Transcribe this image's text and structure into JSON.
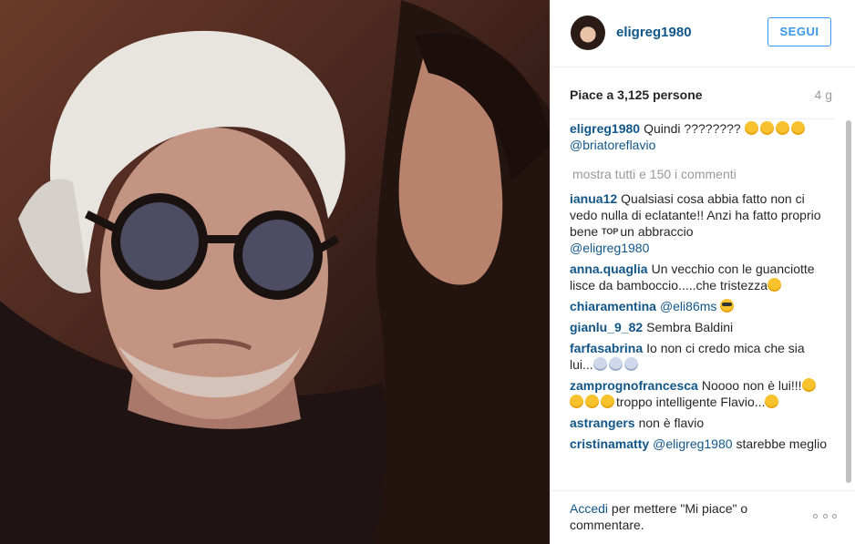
{
  "header": {
    "username": "eligreg1980",
    "follow_label": "SEGUI"
  },
  "stats": {
    "likes": "Piace a 3,125 persone",
    "age": "4 g"
  },
  "caption": {
    "author": "eligreg1980",
    "text": "Quindi ????????",
    "emojis": [
      "grinning-squint-face",
      "winking-tongue-face",
      "tears-of-joy-face",
      "smirking-face"
    ],
    "mention": "@briatoreflavio"
  },
  "show_all_comments": "mostra tutti e 150 i commenti",
  "comments": [
    {
      "author": "ianua12",
      "text": "Qualsiasi cosa abbia fatto non ci vedo nulla di eclatante!! Anzi ha fatto proprio bene",
      "glyph": "TOP",
      "text2": "un abbraccio",
      "mention": "@eligreg1980"
    },
    {
      "author": "anna.quaglia",
      "text": "Un vecchio con le guanciotte lisce da bamboccio.....che tristezza"
    },
    {
      "author": "chiaramentina",
      "mention": "@eli86ms"
    },
    {
      "author": "gianlu_9_82",
      "text": "Sembra Baldini"
    },
    {
      "author": "farfasabrina",
      "text": "Io non ci credo mica che sia lui..."
    },
    {
      "author": "zamprognofrancesca",
      "text": "Noooo non è lui!!!",
      "text2": "troppo intelligente Flavio..."
    },
    {
      "author": "astrangers",
      "text": "non è flavio"
    },
    {
      "author": "cristinamatty",
      "mention": "@eligreg1980",
      "text": "starebbe meglio"
    }
  ],
  "footer": {
    "login_link": "Accedi",
    "login_text": "per mettere \"Mi piace\" o commentare."
  },
  "colors": {
    "link": "#125688",
    "follow": "#3897f0",
    "muted": "#999999"
  }
}
